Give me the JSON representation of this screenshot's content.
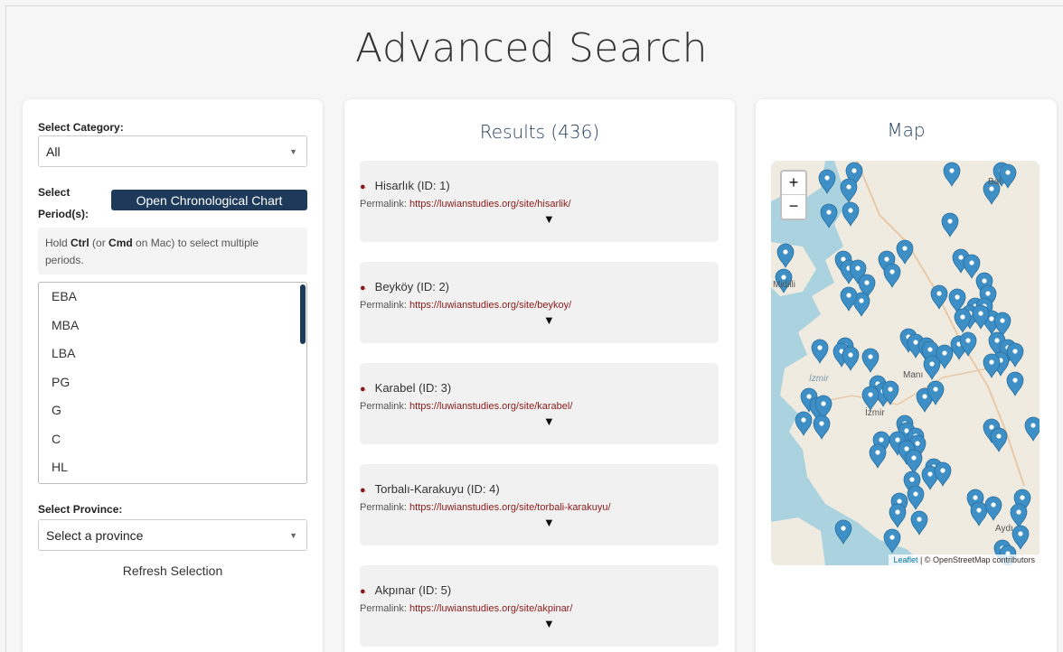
{
  "page": {
    "title": "Advanced Search"
  },
  "filters": {
    "category_label": "Select Category:",
    "category_value": "All",
    "period_label_line1": "Select",
    "period_label_line2": "Period(s):",
    "chrono_button": "Open Chronological Chart",
    "hint_prefix": "Hold ",
    "hint_ctrl": "Ctrl",
    "hint_middle": " (or ",
    "hint_cmd": "Cmd",
    "hint_suffix_line1": " on Mac) to select multiple",
    "hint_suffix_line2": "periods.",
    "periods": [
      "EBA",
      "MBA",
      "LBA",
      "PG",
      "G",
      "C",
      "HL"
    ],
    "province_label": "Select Province:",
    "province_placeholder": "Select a province",
    "refresh_label": "Refresh Selection"
  },
  "results": {
    "title": "Results (436)",
    "permalink_label": "Permalink: ",
    "toggle_glyph": "▼",
    "items": [
      {
        "name": "Hisarlık (ID: 1)",
        "url": "https://luwianstudies.org/site/hisarlik/"
      },
      {
        "name": "Beyköy (ID: 2)",
        "url": "https://luwianstudies.org/site/beykoy/"
      },
      {
        "name": "Karabel (ID: 3)",
        "url": "https://luwianstudies.org/site/karabel/"
      },
      {
        "name": "Torbalı-Karakuyu (ID: 4)",
        "url": "https://luwianstudies.org/site/torbali-karakuyu/"
      },
      {
        "name": "Akpınar (ID: 5)",
        "url": "https://luwianstudies.org/site/akpinar/"
      }
    ]
  },
  "map": {
    "title": "Map",
    "zoom_in": "+",
    "zoom_out": "−",
    "attribution_leaflet": "Leaflet",
    "attribution_rest": " | © OpenStreetMap contributors",
    "place_labels": [
      "Bal",
      "Manı",
      "İzmir",
      "İzmir",
      "Aydı",
      "Midilli"
    ],
    "colors": {
      "marker": "#3d8fc6",
      "land": "#f0ebe0",
      "sea": "#aad3df"
    }
  },
  "colors": {
    "accent": "#1e3a5a",
    "link": "#8b1a1a",
    "heading": "#1f3d5c"
  }
}
